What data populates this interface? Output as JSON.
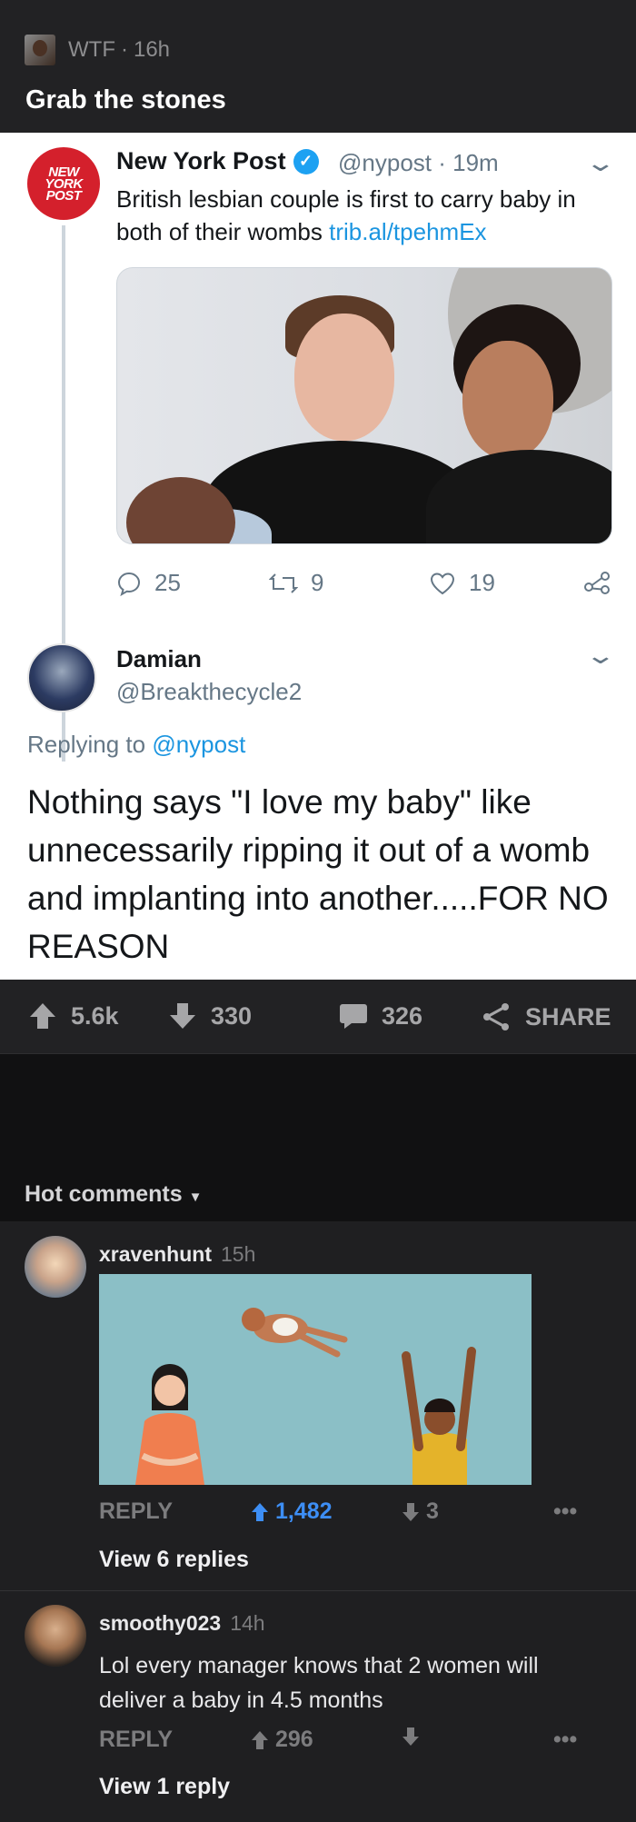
{
  "post": {
    "subreddit": "WTF",
    "age": "16h",
    "meta_sep": "·",
    "title": "Grab the stones"
  },
  "tweet": {
    "logo_lines": [
      "NEW",
      "YORK",
      "POST"
    ],
    "name": "New York Post",
    "handle": "@nypost · 19m",
    "text": "British lesbian couple is first to carry baby in both of their wombs ",
    "link": "trib.al/tpehmEx",
    "replies": "25",
    "retweets": "9",
    "likes": "19"
  },
  "reply_tweet": {
    "name": "Damian",
    "handle": "@Breakthecycle2",
    "replying_prefix": "Replying to ",
    "replying_to": "@nypost",
    "text": "Nothing says \"I love my baby\" like unnecessarily ripping it out of a womb and implanting into another.....FOR NO REASON"
  },
  "votes": {
    "upvotes": "5.6k",
    "downvotes": "330",
    "comments": "326",
    "share_label": "SHARE"
  },
  "comments_section": {
    "sort_label": "Hot comments",
    "comments": [
      {
        "user": "xravenhunt",
        "time": "15h",
        "reply_label": "REPLY",
        "upvotes": "1,482",
        "downvotes": "3",
        "view_replies": "View 6 replies"
      },
      {
        "user": "smoothy023",
        "time": "14h",
        "text": "Lol every manager knows that 2 women will deliver a baby in 4.5 months",
        "reply_label": "REPLY",
        "upvotes": "296",
        "downvotes": "",
        "view_replies": "View 1 reply"
      }
    ]
  },
  "colors": {
    "twitter_blue": "#1da1f2",
    "link_blue": "#1b95e0",
    "upvote_active": "#3d8ef5",
    "nypost_red": "#d4202c",
    "background": "#111112",
    "panel": "#222224"
  }
}
